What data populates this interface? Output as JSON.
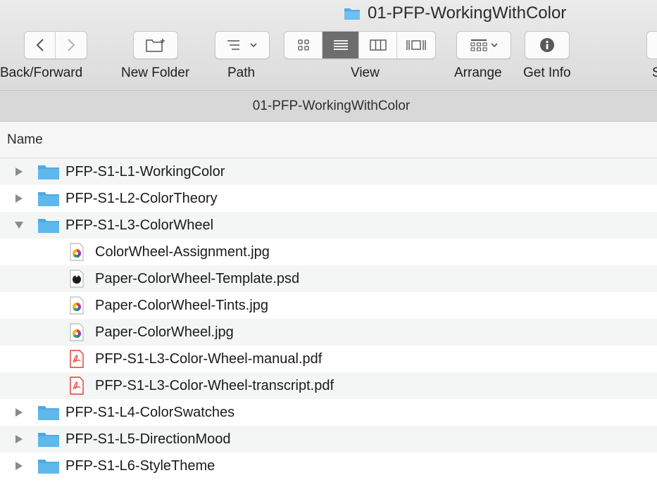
{
  "window": {
    "title": "01-PFP-WorkingWithColor"
  },
  "toolbar": {
    "back_forward_label": "Back/Forward",
    "new_folder_label": "New Folder",
    "path_label": "Path",
    "view_label": "View",
    "arrange_label": "Arrange",
    "get_info_label": "Get Info",
    "cut_label": "S"
  },
  "path_bar": {
    "current": "01-PFP-WorkingWithColor"
  },
  "columns": {
    "name": "Name"
  },
  "rows": [
    {
      "kind": "folder",
      "expanded": false,
      "name": "PFP-S1-L1-WorkingColor"
    },
    {
      "kind": "folder",
      "expanded": false,
      "name": "PFP-S1-L2-ColorTheory"
    },
    {
      "kind": "folder",
      "expanded": true,
      "name": "PFP-S1-L3-ColorWheel"
    },
    {
      "kind": "file",
      "icon": "image-file-icon",
      "name": "ColorWheel-Assignment.jpg"
    },
    {
      "kind": "file",
      "icon": "photoshop-file-icon",
      "name": "Paper-ColorWheel-Template.psd"
    },
    {
      "kind": "file",
      "icon": "image-file-icon",
      "name": "Paper-ColorWheel-Tints.jpg"
    },
    {
      "kind": "file",
      "icon": "image-file-icon",
      "name": "Paper-ColorWheel.jpg"
    },
    {
      "kind": "file",
      "icon": "pdf-file-icon",
      "name": "PFP-S1-L3-Color-Wheel-manual.pdf"
    },
    {
      "kind": "file",
      "icon": "pdf-file-icon",
      "name": "PFP-S1-L3-Color-Wheel-transcript.pdf"
    },
    {
      "kind": "folder",
      "expanded": false,
      "name": "PFP-S1-L4-ColorSwatches"
    },
    {
      "kind": "folder",
      "expanded": false,
      "name": "PFP-S1-L5-DirectionMood"
    },
    {
      "kind": "folder",
      "expanded": false,
      "name": "PFP-S1-L6-StyleTheme"
    }
  ],
  "colors": {
    "folder_blue": "#5fb8ec",
    "active_segment": "#6d6d6d",
    "pdf_red": "#e23b32"
  }
}
